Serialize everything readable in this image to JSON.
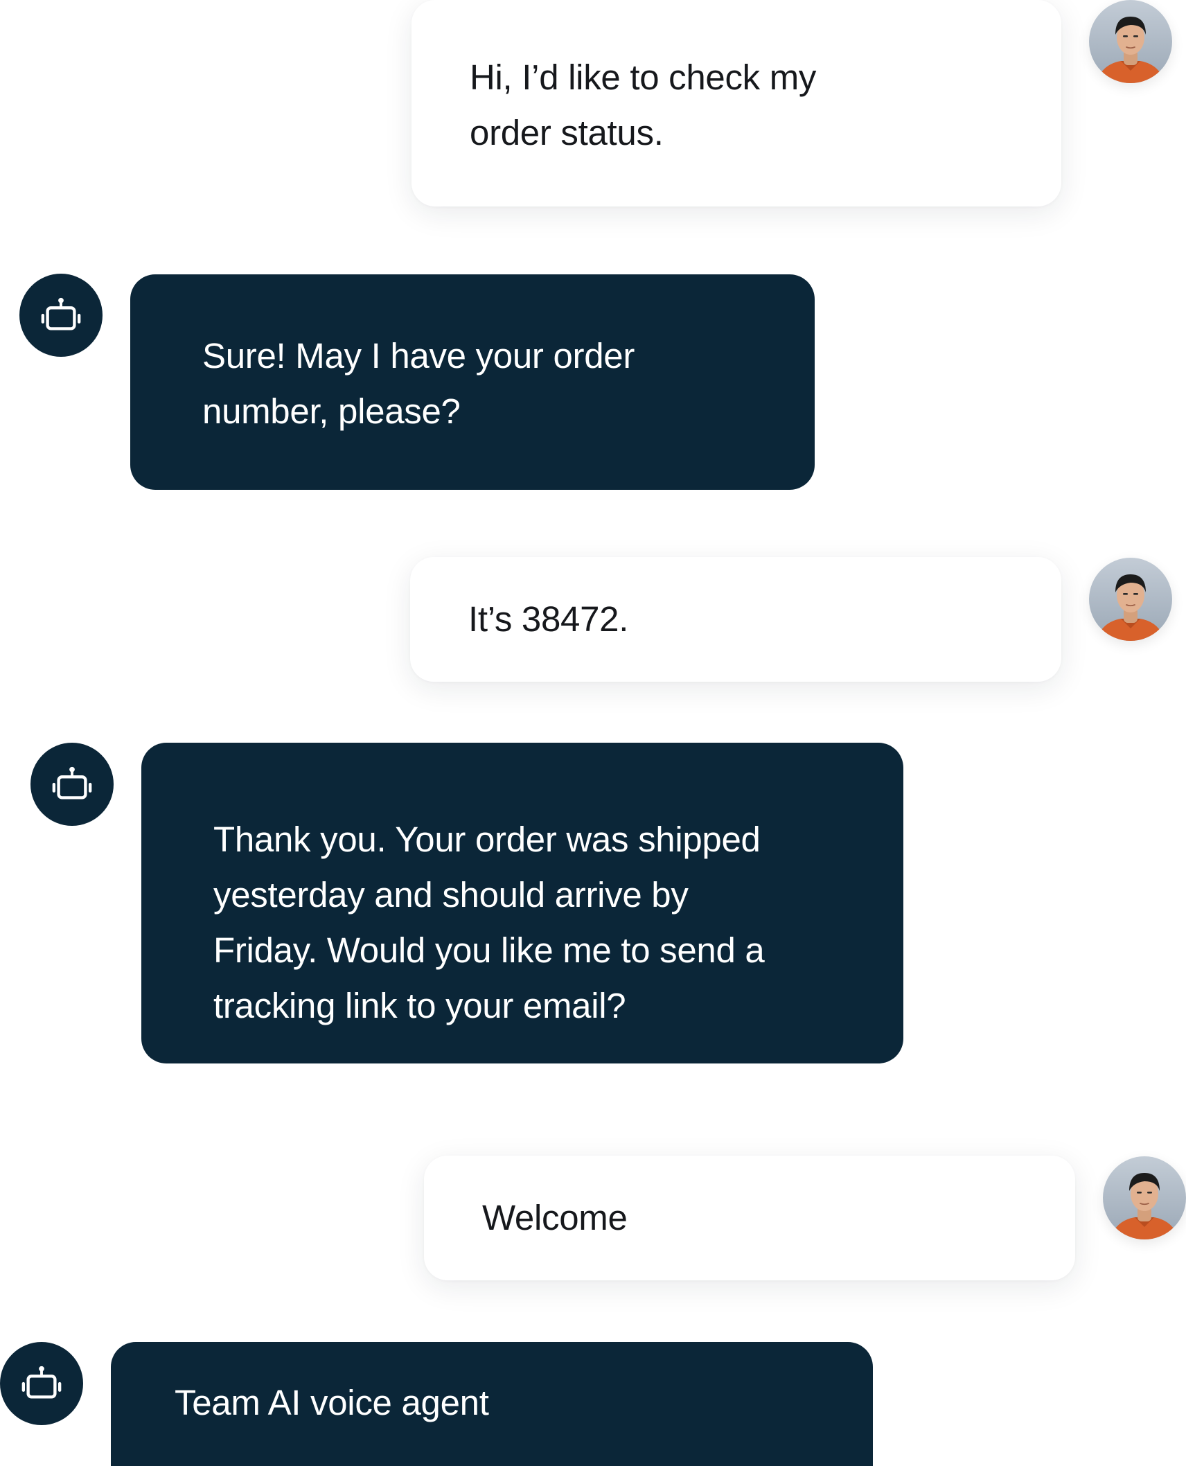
{
  "colors": {
    "agent_bubble": "#0b2638",
    "user_bubble": "#ffffff",
    "agent_text": "#ffffff",
    "user_text": "#16181c"
  },
  "icons": {
    "user_avatar": "user-avatar-photo",
    "agent_avatar": "robot-icon"
  },
  "messages": [
    {
      "sender": "user",
      "text": "Hi, I’d like to check my\norder status."
    },
    {
      "sender": "agent",
      "text": "Sure! May I have your order\nnumber, please?"
    },
    {
      "sender": "user",
      "text": "It’s 38472."
    },
    {
      "sender": "agent",
      "text": "Thank you. Your order was shipped\nyesterday and should arrive by\nFriday. Would you like me to send a\ntracking link to your email?"
    },
    {
      "sender": "user",
      "text": "Welcome"
    },
    {
      "sender": "agent",
      "text": "Team AI voice agent"
    }
  ]
}
